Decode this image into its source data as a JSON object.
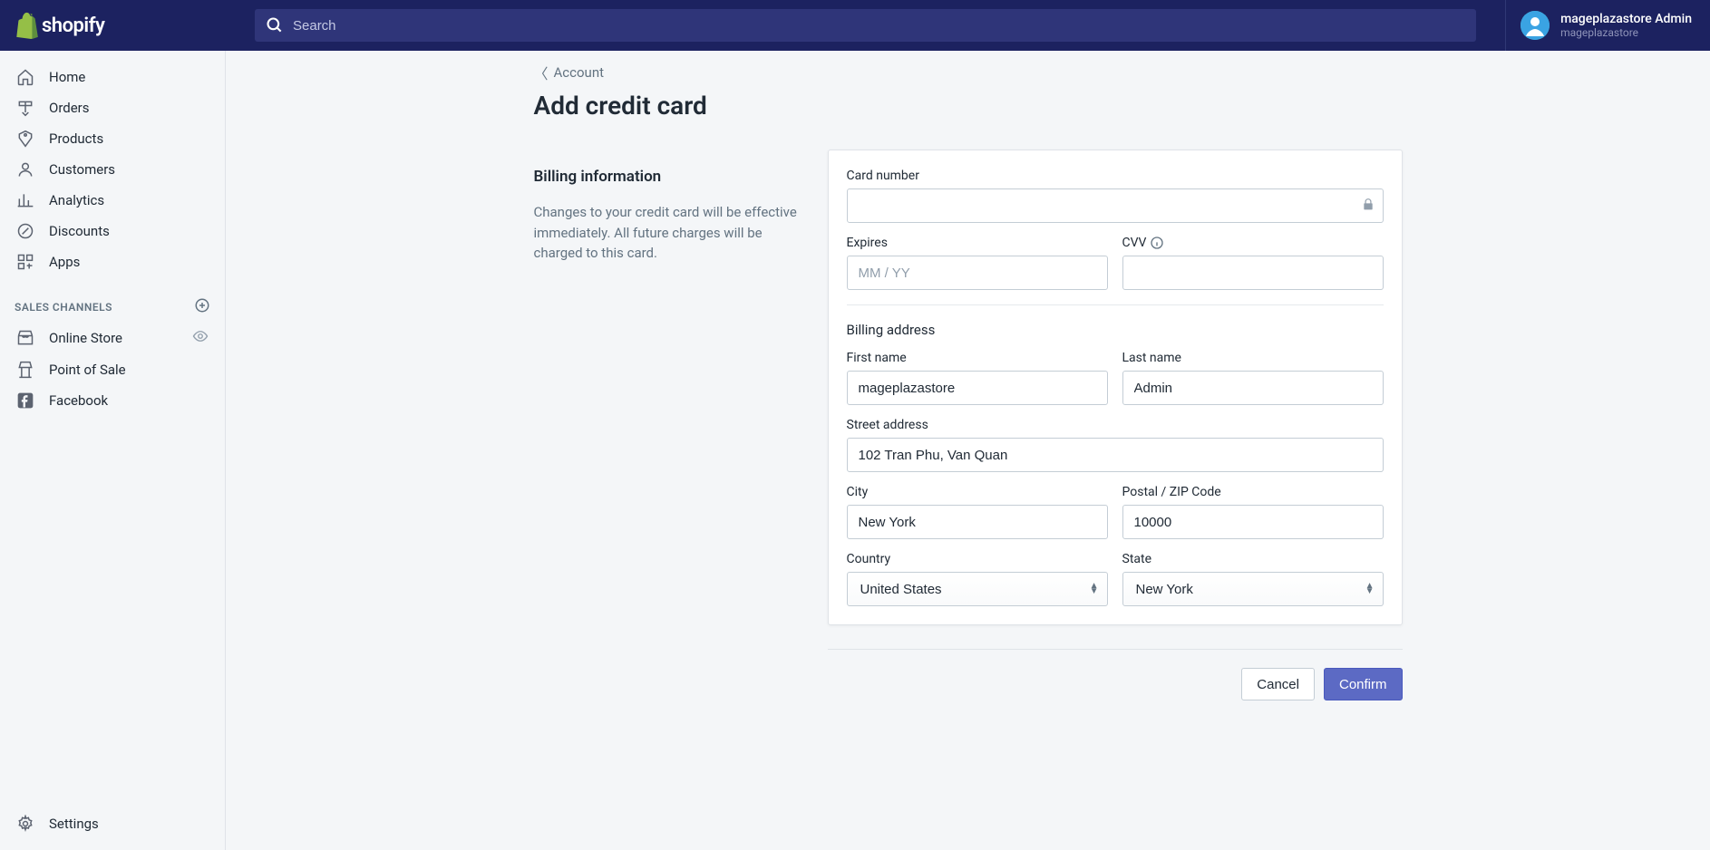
{
  "brand": "shopify",
  "search": {
    "placeholder": "Search"
  },
  "user": {
    "name": "mageplazastore Admin",
    "store": "mageplazastore"
  },
  "nav": {
    "home": "Home",
    "orders": "Orders",
    "products": "Products",
    "customers": "Customers",
    "analytics": "Analytics",
    "discounts": "Discounts",
    "apps": "Apps",
    "settings": "Settings"
  },
  "salesChannels": {
    "header": "SALES CHANNELS",
    "onlineStore": "Online Store",
    "pointOfSale": "Point of Sale",
    "facebook": "Facebook"
  },
  "breadcrumb": {
    "label": "Account"
  },
  "page": {
    "title": "Add credit card"
  },
  "billing": {
    "sectionTitle": "Billing information",
    "sectionDesc": "Changes to your credit card will be effective immediately. All future charges will be charged to this card.",
    "cardNumber": {
      "label": "Card number",
      "value": ""
    },
    "expires": {
      "label": "Expires",
      "placeholder": "MM / YY",
      "value": ""
    },
    "cvv": {
      "label": "CVV",
      "value": ""
    },
    "addressHeading": "Billing address",
    "firstName": {
      "label": "First name",
      "value": "mageplazastore"
    },
    "lastName": {
      "label": "Last name",
      "value": "Admin"
    },
    "street": {
      "label": "Street address",
      "value": "102 Tran Phu, Van Quan"
    },
    "city": {
      "label": "City",
      "value": "New York"
    },
    "postal": {
      "label": "Postal / ZIP Code",
      "value": "10000"
    },
    "country": {
      "label": "Country",
      "value": "United States"
    },
    "state": {
      "label": "State",
      "value": "New York"
    }
  },
  "actions": {
    "cancel": "Cancel",
    "confirm": "Confirm"
  }
}
